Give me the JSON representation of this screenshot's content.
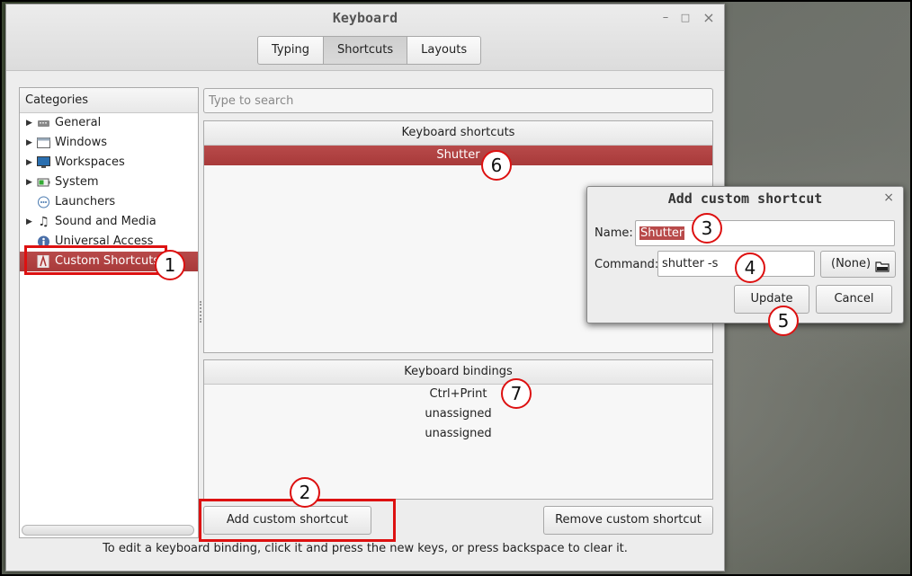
{
  "window": {
    "title": "Keyboard",
    "controls": {
      "minimize": "–",
      "maximize": "□",
      "close": "×"
    }
  },
  "tabs": [
    {
      "label": "Typing"
    },
    {
      "label": "Shortcuts"
    },
    {
      "label": "Layouts"
    }
  ],
  "categories": {
    "header": "Categories",
    "items": [
      {
        "label": "General",
        "icon": "keyboard-icon"
      },
      {
        "label": "Windows",
        "icon": "window-icon"
      },
      {
        "label": "Workspaces",
        "icon": "monitor-icon"
      },
      {
        "label": "System",
        "icon": "battery-icon"
      },
      {
        "label": "Launchers",
        "icon": "launcher-icon"
      },
      {
        "label": "Sound and Media",
        "icon": "music-note-icon"
      },
      {
        "label": "Universal Access",
        "icon": "accessibility-icon"
      },
      {
        "label": "Custom Shortcuts",
        "icon": "custom-shortcut-icon"
      }
    ]
  },
  "search": {
    "placeholder": "Type to search"
  },
  "shortcuts": {
    "header": "Keyboard shortcuts",
    "rows": [
      "Shutter"
    ]
  },
  "bindings": {
    "header": "Keyboard bindings",
    "rows": [
      "Ctrl+Print",
      "unassigned",
      "unassigned"
    ]
  },
  "buttons": {
    "add": "Add custom shortcut",
    "remove": "Remove custom shortcut"
  },
  "hint": "To edit a keyboard binding, click it and press the new keys, or press backspace to clear it.",
  "dialog": {
    "title": "Add custom shortcut",
    "close": "×",
    "name_label": "Name:",
    "name_value": "Shutter",
    "command_label": "Command:",
    "command_value": "shutter -s",
    "file_button": "(None)",
    "update": "Update",
    "cancel": "Cancel"
  },
  "annotations": [
    "1",
    "2",
    "3",
    "4",
    "5",
    "6",
    "7"
  ],
  "colors": {
    "accent": "#b84a4a",
    "annotation": "#dd1111"
  }
}
